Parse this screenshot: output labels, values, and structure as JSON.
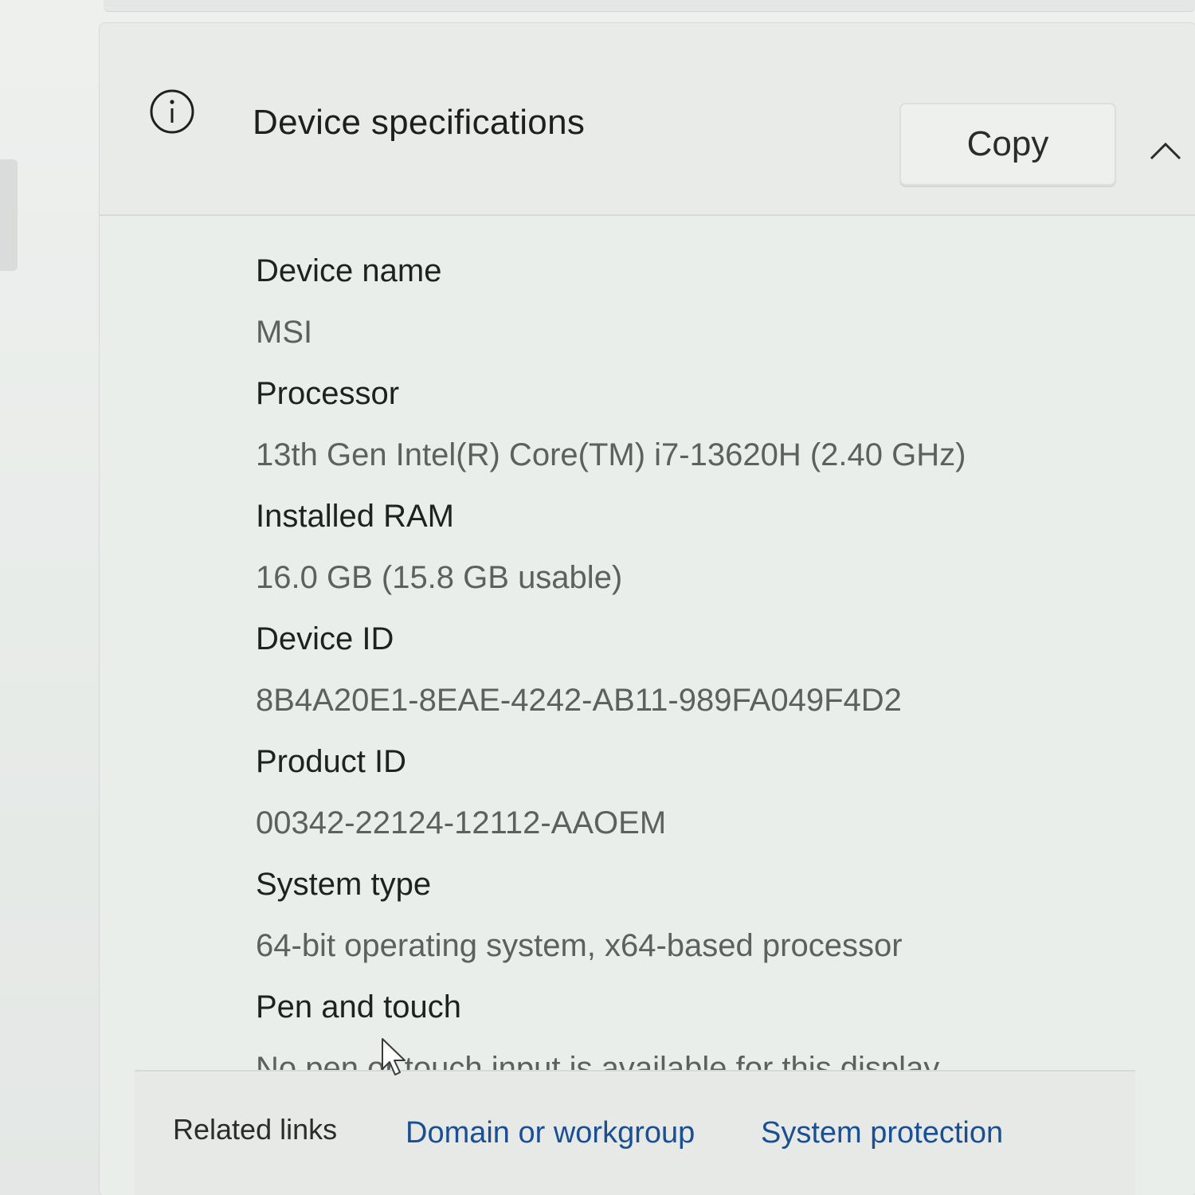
{
  "section": {
    "title": "Device specifications",
    "icon": "info-icon",
    "copy_label": "Copy",
    "collapse_icon": "chevron-up-icon"
  },
  "specs": [
    {
      "label": "Device name",
      "value": "MSI"
    },
    {
      "label": "Processor",
      "value": "13th Gen Intel(R) Core(TM) i7-13620H (2.40 GHz)"
    },
    {
      "label": "Installed RAM",
      "value": "16.0 GB (15.8 GB usable)"
    },
    {
      "label": "Device ID",
      "value": "8B4A20E1-8EAE-4242-AB11-989FA049F4D2"
    },
    {
      "label": "Product ID",
      "value": "00342-22124-12112-AAOEM"
    },
    {
      "label": "System type",
      "value": "64-bit operating system, x64-based processor"
    },
    {
      "label": "Pen and touch",
      "value": "No pen or touch input is available for this display"
    }
  ],
  "related": {
    "label": "Related links",
    "links": [
      "Domain or workgroup",
      "System protection"
    ]
  },
  "colors": {
    "link": "#1a4f93",
    "background": "#eaeeea"
  }
}
